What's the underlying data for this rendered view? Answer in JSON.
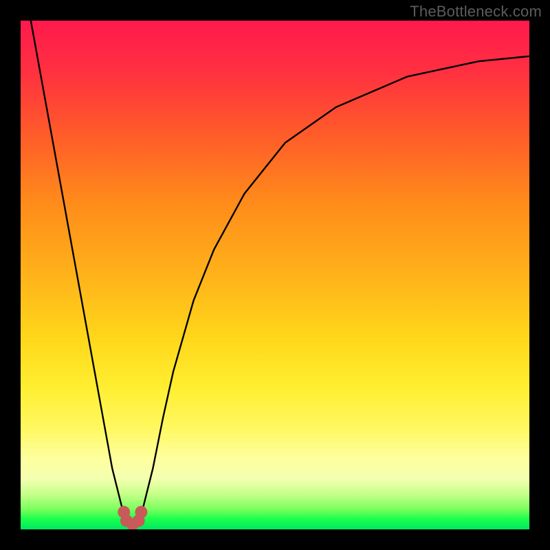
{
  "watermark": "TheBottleneck.com",
  "chart_data": {
    "type": "line",
    "title": "",
    "xlabel": "",
    "ylabel": "",
    "xlim": [
      0,
      100
    ],
    "ylim": [
      0,
      100
    ],
    "grid": false,
    "legend": false,
    "series": [
      {
        "name": "bottleneck-curve",
        "x": [
          2,
          4,
          6,
          8,
          10,
          12,
          14,
          16,
          18,
          20,
          21,
          22,
          23,
          24,
          26,
          28,
          30,
          34,
          38,
          44,
          52,
          62,
          76,
          90,
          100
        ],
        "y": [
          100,
          89,
          78,
          67,
          56,
          45,
          34,
          23,
          12,
          4,
          1.5,
          1,
          1.5,
          4,
          12,
          22,
          31,
          45,
          55,
          66,
          76,
          83,
          89,
          92,
          93
        ]
      }
    ],
    "markers": [
      {
        "name": "dip-marker-left-1",
        "x": 20.3,
        "y": 3.4
      },
      {
        "name": "dip-marker-left-2",
        "x": 20.8,
        "y": 1.7
      },
      {
        "name": "dip-marker-center",
        "x": 22.0,
        "y": 1.0
      },
      {
        "name": "dip-marker-right-1",
        "x": 23.2,
        "y": 1.7
      },
      {
        "name": "dip-marker-right-2",
        "x": 23.7,
        "y": 3.4
      }
    ],
    "gradient_stops": [
      {
        "pos": 0,
        "color": "#ff1a4d"
      },
      {
        "pos": 50,
        "color": "#ffd61a"
      },
      {
        "pos": 86,
        "color": "#feff9e"
      },
      {
        "pos": 100,
        "color": "#00e860"
      }
    ]
  }
}
